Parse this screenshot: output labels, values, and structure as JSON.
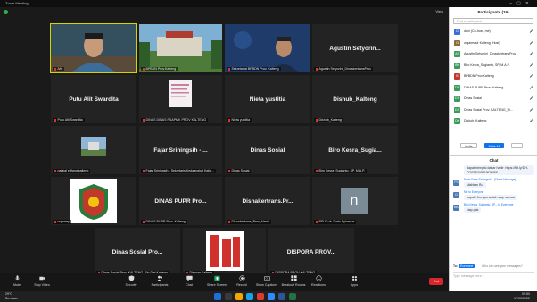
{
  "window": {
    "title": "Zoom Meeting",
    "view_label": "View"
  },
  "tiles": [
    {
      "label": "Afri"
    },
    {
      "label": "BPBDN Prov.Kalteng"
    },
    {
      "label": "Sekretariat BPBDN Prov. Kalteng"
    },
    {
      "center": "Agustin Setyorin...",
      "label": "Agustin Setyorini_DinaskertransProv"
    },
    {
      "center": "Putu Alit Swardita",
      "label": "Putu Alit Swardita"
    },
    {
      "label": "DINAS DINAS PSAPMK PROV KALTENG"
    },
    {
      "center": "Nieta yustitia",
      "label": "Nieta yustitia"
    },
    {
      "center": "Dishub_Kalteng",
      "label": "Dishub_Kalteng"
    },
    {
      "label": "pajajal edfang|kalteng"
    },
    {
      "center": "Fajar Sriningsih - ...",
      "label": "Fajar Sriningsih - Sekretaris Kedaangkat Kalte..."
    },
    {
      "center": "Dinas Sosial",
      "label": "Dinas Sosial"
    },
    {
      "center": "Biro Kesra_Sugia...",
      "label": "Biro Kesra_Sugianto, SP, M.A.P."
    },
    {
      "label": "orgamsp"
    },
    {
      "center": "DINAS PUPR Pro...",
      "label": "DINAS PUPR Prov. Kalteng"
    },
    {
      "center": "Disnakertrans.Pr...",
      "label": "Disnakertrans_Prov_Harni"
    },
    {
      "avatar": "n",
      "label": "PSUD dr. Doris Sylvanus"
    },
    {
      "center": "Dinas Sosial Pro...",
      "label": "Dinas Sosial Prov. KALTENG_Rio Dwi Kalteng"
    },
    {
      "label": "Dispora Kalteng"
    },
    {
      "center": "DISPORA PROV...",
      "label": "DISPORA PROV KALTENG"
    }
  ],
  "toolbar": {
    "buttons": [
      {
        "name": "mute",
        "label": "Mute",
        "icon": "mic-icon"
      },
      {
        "name": "stop-video",
        "label": "Stop Video",
        "icon": "video-icon"
      },
      {
        "name": "security",
        "label": "Security",
        "icon": "shield-icon"
      },
      {
        "name": "participants",
        "label": "Participants",
        "icon": "people-icon"
      },
      {
        "name": "chat",
        "label": "Chat",
        "icon": "chat-icon"
      },
      {
        "name": "share-screen",
        "label": "Share Screen",
        "icon": "share-icon"
      },
      {
        "name": "record",
        "label": "Record",
        "icon": "record-icon"
      },
      {
        "name": "show-captions",
        "label": "Show Captions",
        "icon": "cc-icon"
      },
      {
        "name": "breakout-rooms",
        "label": "Breakout Rooms",
        "icon": "grid-icon"
      },
      {
        "name": "reactions",
        "label": "Reactions",
        "icon": "smile-icon"
      },
      {
        "name": "apps",
        "label": "Apps",
        "icon": "apps-icon"
      }
    ],
    "end_label": "End"
  },
  "participants": {
    "header": "Participants (19)",
    "search_placeholder": "Find a participant",
    "items": [
      {
        "name": "dani (Co-host, me)",
        "avatar": "D",
        "color": "#3b6fd8"
      },
      {
        "name": "orgamsisir Kalteng (Host)",
        "avatar": "O",
        "color": "#8a6d3b"
      },
      {
        "name": "Agustin Setyorini_DinaskertransProv",
        "avatar": "AS",
        "color": "#3a9a5b"
      },
      {
        "name": "Biro Kesra_Sugianto, SP, M.A.P.",
        "avatar": "BK",
        "color": "#3a9a5b"
      },
      {
        "name": "BPBDN Prov.Kalteng",
        "avatar": "B",
        "color": "#c0392b"
      },
      {
        "name": "DINAS PUPR Prov. Kalteng",
        "avatar": "DP",
        "color": "#3a9a5b"
      },
      {
        "name": "Dinas Sosial",
        "avatar": "DS",
        "color": "#3a9a5b"
      },
      {
        "name": "Dinas Sosial Prov. KALTENG_Ri...",
        "avatar": "DS",
        "color": "#3a9a5b"
      },
      {
        "name": "Dishub_Kalteng",
        "avatar": "DK",
        "color": "#3a9a5b"
      }
    ],
    "invite_label": "Invite",
    "mute_all_label": "Mute All",
    "more_label": "..."
  },
  "chat": {
    "header": "Chat",
    "messages": [
      {
        "from": "",
        "text": "dapat mengisi daftar hadir: https://bit.ly/DH-PROFESIS DNR2022",
        "avatar": ""
      },
      {
        "from": "From Fajar Sriningsih... (Direct Message)",
        "text": "silahkan Bu",
        "avatar": "FS"
      },
      {
        "from": "Me to Everyone",
        "text": "bapak/ ibu apa sudah siap semua",
        "avatar": "D"
      },
      {
        "from": "Biro Kesra_Sugianto, SP... to Everyone",
        "text": "siap pak",
        "avatar": "BK"
      }
    ],
    "to_label": "To:",
    "to_value": "Everyone",
    "who_can_see": "Who can see your messages?",
    "input_placeholder": "Type message here..."
  },
  "taskbar": {
    "weather_temp": "29°C",
    "weather_desc": "Berawan",
    "time": "09:50",
    "date": "17/03/2022"
  }
}
